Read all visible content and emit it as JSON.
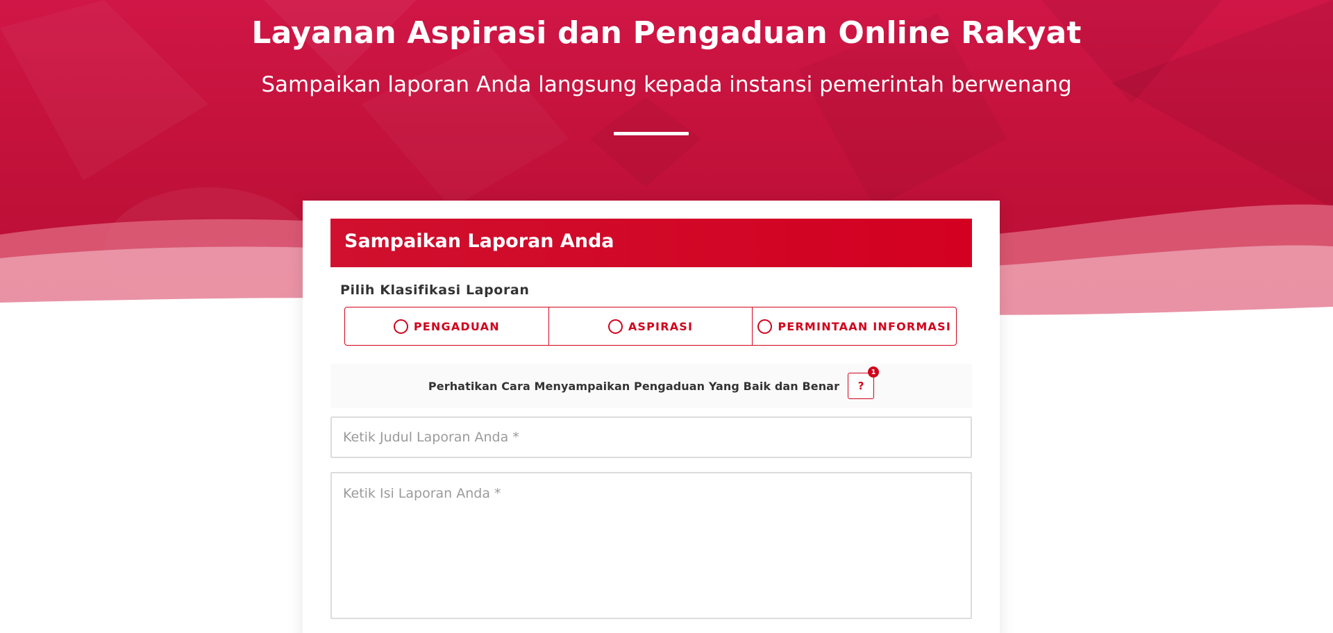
{
  "hero": {
    "title": "Layanan Aspirasi dan Pengaduan Online Rakyat",
    "subtitle": "Sampaikan laporan Anda langsung kepada instansi pemerintah berwenang"
  },
  "form": {
    "header": "Sampaikan Laporan Anda",
    "classification_label": "Pilih Klasifikasi Laporan",
    "classification_options": [
      "PENGADUAN",
      "ASPIRASI",
      "PERMINTAAN INFORMASI"
    ],
    "notice_text": "Perhatikan Cara Menyampaikan Pengaduan Yang Baik dan Benar",
    "help_button_label": "?",
    "help_badge_count": "1",
    "title_placeholder": "Ketik Judul Laporan Anda *",
    "body_placeholder": "Ketik Isi Laporan Anda *"
  },
  "colors": {
    "brand_red": "#d0021b",
    "hero_red": "#c4123c"
  },
  "icons": {
    "radio": "radio-unchecked-icon",
    "help": "question-mark-icon"
  }
}
